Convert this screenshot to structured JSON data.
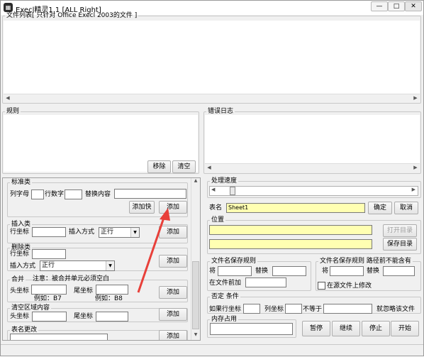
{
  "titlebar": {
    "title": "Execl精灵1.1  [ALL Right]",
    "icon": "spreadsheet-icon",
    "minimize": "—",
    "maximize": "□",
    "close": "✕"
  },
  "file_list": {
    "legend": "文件列表[ 只针对 Office Execl 2003的文件 ]"
  },
  "rules": {
    "legend": "规则",
    "remove": "移除",
    "clear": "清空"
  },
  "error_log": {
    "legend": "错误日志"
  },
  "standard": {
    "legend": "标准类",
    "col_label": "列字母",
    "row_label": "行数字",
    "replace_label": "替换内容",
    "add_block": "添加快",
    "add": "添加"
  },
  "insert": {
    "legend": "插入类",
    "row_label": "行坐标",
    "mode_label": "插入方式",
    "mode_value": "正行",
    "add": "添加"
  },
  "delete": {
    "legend": "删除类",
    "row_label": "行坐标",
    "mode_label": "插入方式",
    "mode_value": "正行",
    "add": "添加"
  },
  "merge": {
    "legend": "合并",
    "note": "注意：被合并单元必须空白",
    "start_label": "头坐标",
    "end_label": "尾坐标",
    "example1": "例如：B7",
    "example2": "例如：B8",
    "add": "添加"
  },
  "clear_region": {
    "legend": "清空区域内容",
    "start_label": "头坐标",
    "end_label": "尾坐标",
    "add": "添加"
  },
  "table_rename": {
    "legend": "表名更改",
    "add": "添加"
  },
  "speed": {
    "legend": "处理速度",
    "progress": 0.06
  },
  "sheet": {
    "label": "表名",
    "value": "Sheet1",
    "confirm": "确定",
    "cancel": "取消"
  },
  "location": {
    "legend": "位置",
    "open_dir": "打开目录",
    "save_dir": "保存目录"
  },
  "filename_save": {
    "legend": "文件名保存规则",
    "replace_prefix": "将",
    "replace_with": "替换",
    "append_label": "在文件前加"
  },
  "filename_save2": {
    "legend": "文件名保存规则  路径前不能含有",
    "replace_prefix": "将",
    "replace_with": "替换",
    "inplace_label": "在源文件上修改"
  },
  "negation": {
    "legend": "否定 条件",
    "row_label": "如果行坐标",
    "col_label": "列坐标",
    "neq_label": "不等于",
    "ignore_label": "就忽略该文件"
  },
  "memory": {
    "legend": "内存占用"
  },
  "controls": {
    "pause": "暂停",
    "resume": "继续",
    "stop": "停止",
    "start": "开始"
  },
  "colors": {
    "yellow_field": "#ffffb2",
    "arrow": "#e8403a"
  }
}
